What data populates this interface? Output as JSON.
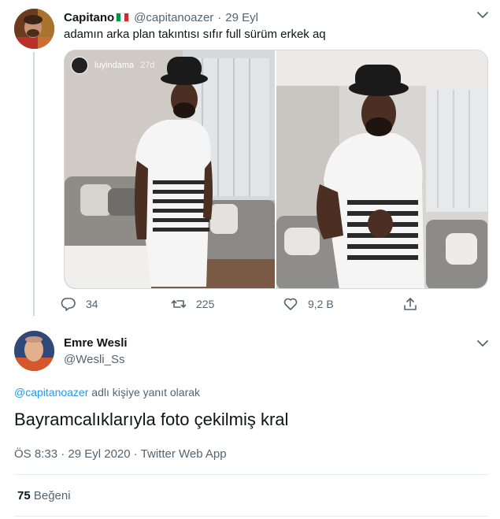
{
  "tweet1": {
    "name": "Capitano",
    "handle": "@capitanoazer",
    "separator": "·",
    "time": "29 Eyl",
    "text": "adamın arka plan takıntısı sıfır full sürüm erkek aq",
    "flag_colors": [
      "#009246",
      "#ffffff",
      "#ce2b37"
    ],
    "story": {
      "user": "luyindama",
      "age": "27d"
    },
    "actions": {
      "replies": "34",
      "retweets": "225",
      "likes": "9,2 B"
    }
  },
  "tweet2": {
    "name": "Emre Wesli",
    "handle": "@Wesli_Ss",
    "reply_mention": "@capitanoazer",
    "reply_suffix": " adlı kişiye yanıt olarak",
    "text": "Bayramcalıklarıyla foto çekilmiş kral",
    "meta": "ÖS 8:33 · 29 Eyl 2020 · Twitter Web App",
    "like_count": "75",
    "like_label": "Beğeni"
  },
  "colors": {
    "text_primary": "#0f1419",
    "text_secondary": "#536471",
    "link": "#1d9bf0",
    "border": "#cfd9de"
  }
}
